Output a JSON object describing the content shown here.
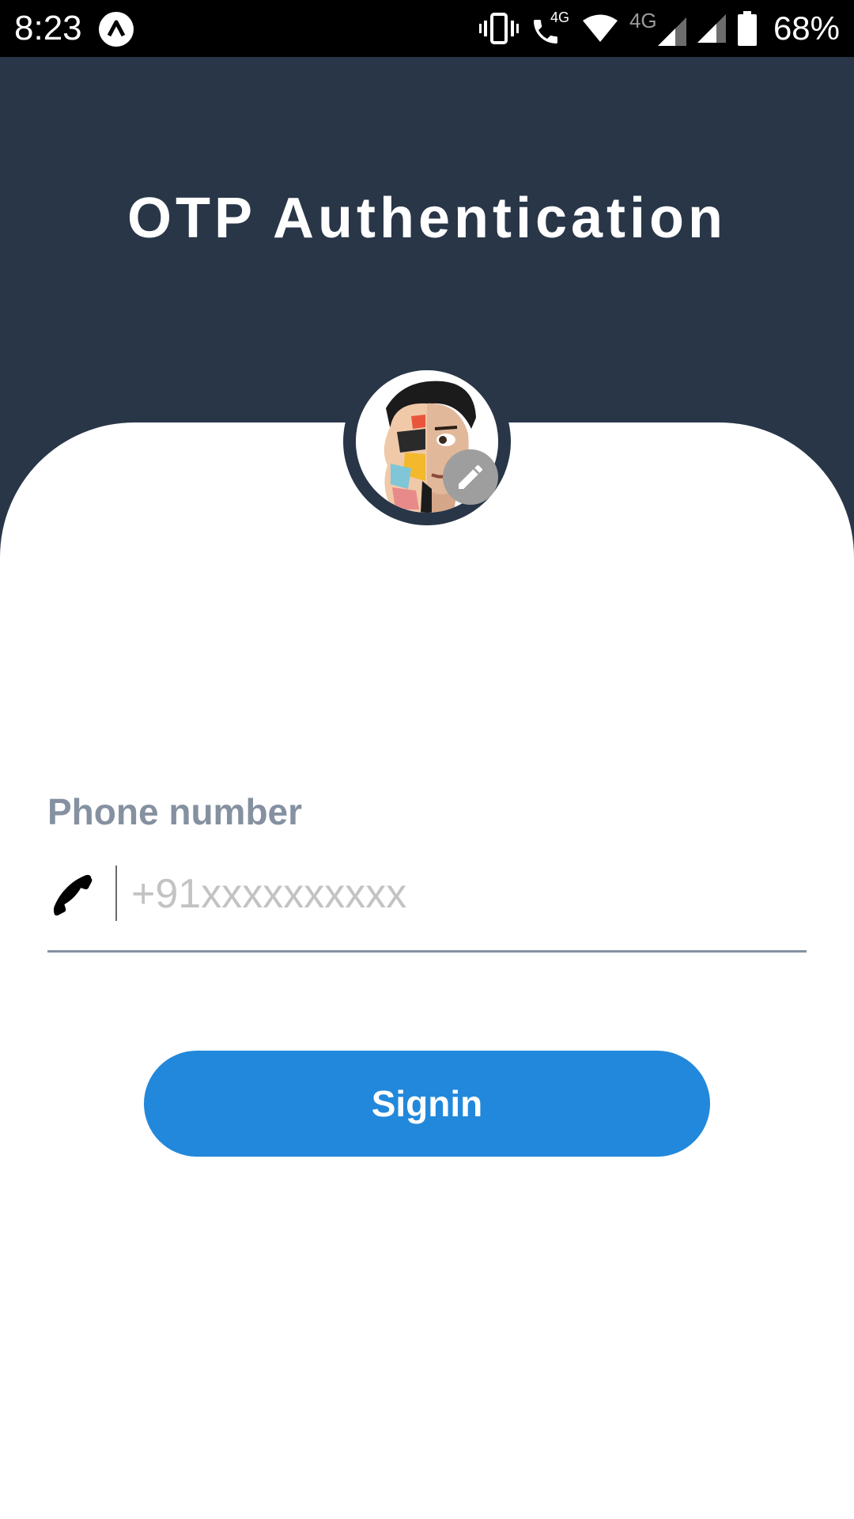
{
  "status_bar": {
    "time": "8:23",
    "battery_percent": "68%",
    "network_labels": [
      "4G",
      "4G"
    ],
    "icons": [
      "app-notification-icon",
      "vibrate-icon",
      "volte-call-icon",
      "wifi-icon",
      "signal-icon",
      "signal-icon",
      "battery-icon"
    ]
  },
  "header": {
    "title": "OTP Authentication",
    "background_color": "#283648"
  },
  "avatar": {
    "edit_icon": "pencil-icon"
  },
  "form": {
    "phone_label": "Phone number",
    "phone_icon": "phone-icon",
    "phone_placeholder": "+91xxxxxxxxxx",
    "phone_value": ""
  },
  "signin_button": {
    "label": "Signin",
    "color": "#2288db"
  }
}
